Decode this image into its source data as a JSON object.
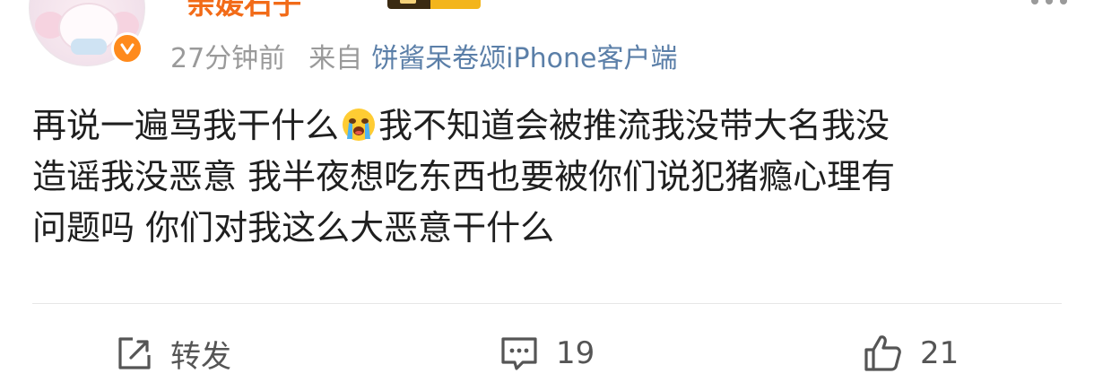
{
  "header": {
    "username": "亲媛石子",
    "time": "27分钟前",
    "from_label": "来自",
    "source": "饼酱呆卷颂iPhone客户端"
  },
  "post": {
    "lines": [
      "再说一遍骂我干什么",
      "我不知道会被推流我没带大名我没",
      "造谣我没恶意 我半夜想吃东西也要被你们说犯猪瘾心理有",
      "问题吗 你们对我这么大恶意干什么"
    ],
    "emoji": "crying-face"
  },
  "actions": {
    "repost_label": "转发",
    "comment_count": "19",
    "like_count": "21"
  },
  "colors": {
    "username": "#f26b18",
    "source_link": "#5b7fa8",
    "meta_gray": "#9a9a9a",
    "badge_orange": "#ff8a1c",
    "text": "#1f1f1f",
    "action_icon": "#555555"
  },
  "icons": [
    "avatar",
    "verified-badge-icon",
    "more-icon",
    "crying-emoji-icon",
    "repost-icon",
    "comment-icon",
    "like-icon"
  ]
}
